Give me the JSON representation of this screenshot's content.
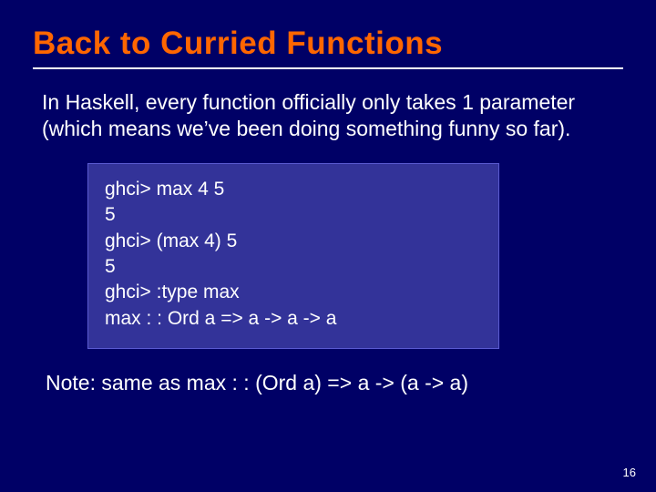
{
  "title": "Back to Curried Functions",
  "intro": "In Haskell, every function officially only takes 1 parameter (which means we’ve been doing something funny so far).",
  "code": {
    "l1": "ghci> max 4 5",
    "l2": "5",
    "l3": "ghci> (max 4) 5",
    "l4": "5",
    "l5": "ghci> :type max",
    "l6": "max : : Ord a => a -> a -> a"
  },
  "note": "Note: same as max : : (Ord a) => a -> (a -> a)",
  "page": "16"
}
